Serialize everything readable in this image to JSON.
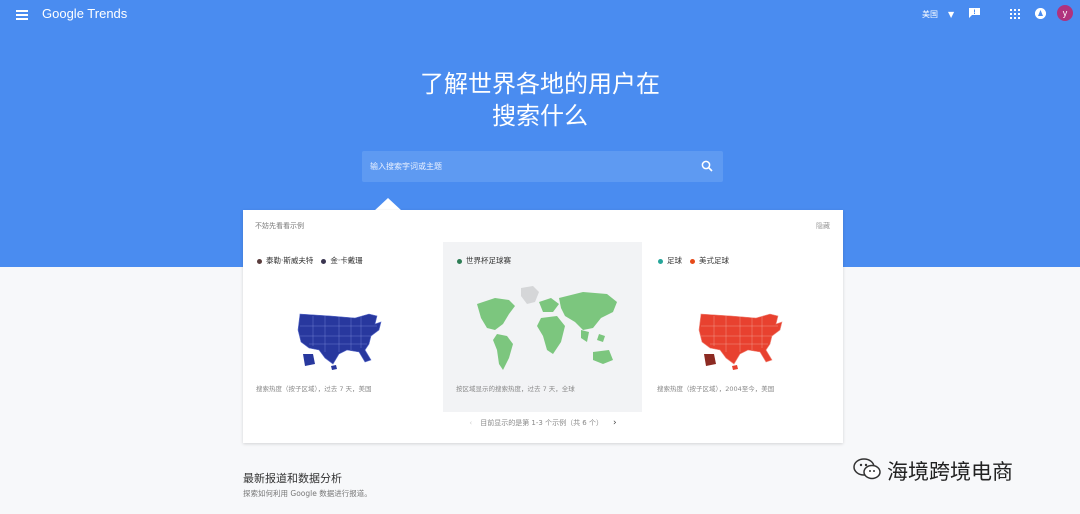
{
  "header": {
    "logo": "Google Trends",
    "region": "美国",
    "avatar_letter": "y"
  },
  "hero": {
    "headline_line1": "了解世界各地的用户在",
    "headline_line2": "搜索什么"
  },
  "search": {
    "placeholder": "输入搜索字词或主题"
  },
  "examples": {
    "heading": "不妨先看看示例",
    "dismiss": "隐藏",
    "panels": [
      {
        "terms": [
          {
            "label": "泰勒·斯威夫特",
            "color": "#3f51b5"
          },
          {
            "label": "金·卡戴珊",
            "color": "#1a237e"
          }
        ],
        "map_color": "#28389e",
        "footer": "搜索热度（按子区域），过去 7 天，美国"
      },
      {
        "terms": [
          {
            "label": "世界杯足球赛",
            "color": "#4caf50"
          }
        ],
        "map_color": "#7cc67e",
        "footer": "按区域显示的搜索热度，过去 7 天，全球"
      },
      {
        "terms": [
          {
            "label": "足球",
            "color": "#26a69a"
          },
          {
            "label": "美式足球",
            "color": "#e64a19"
          }
        ],
        "map_color": "#e8412f",
        "footer": "搜索热度（按子区域），2004至今，美国"
      }
    ],
    "pager_text": "目前显示的是第 1-3 个示例（共 6 个）"
  },
  "news": {
    "title": "最新报道和数据分析",
    "subtitle": "探索如何利用 Google 数据进行报道。"
  },
  "watermark": {
    "text": "海境跨境电商"
  }
}
